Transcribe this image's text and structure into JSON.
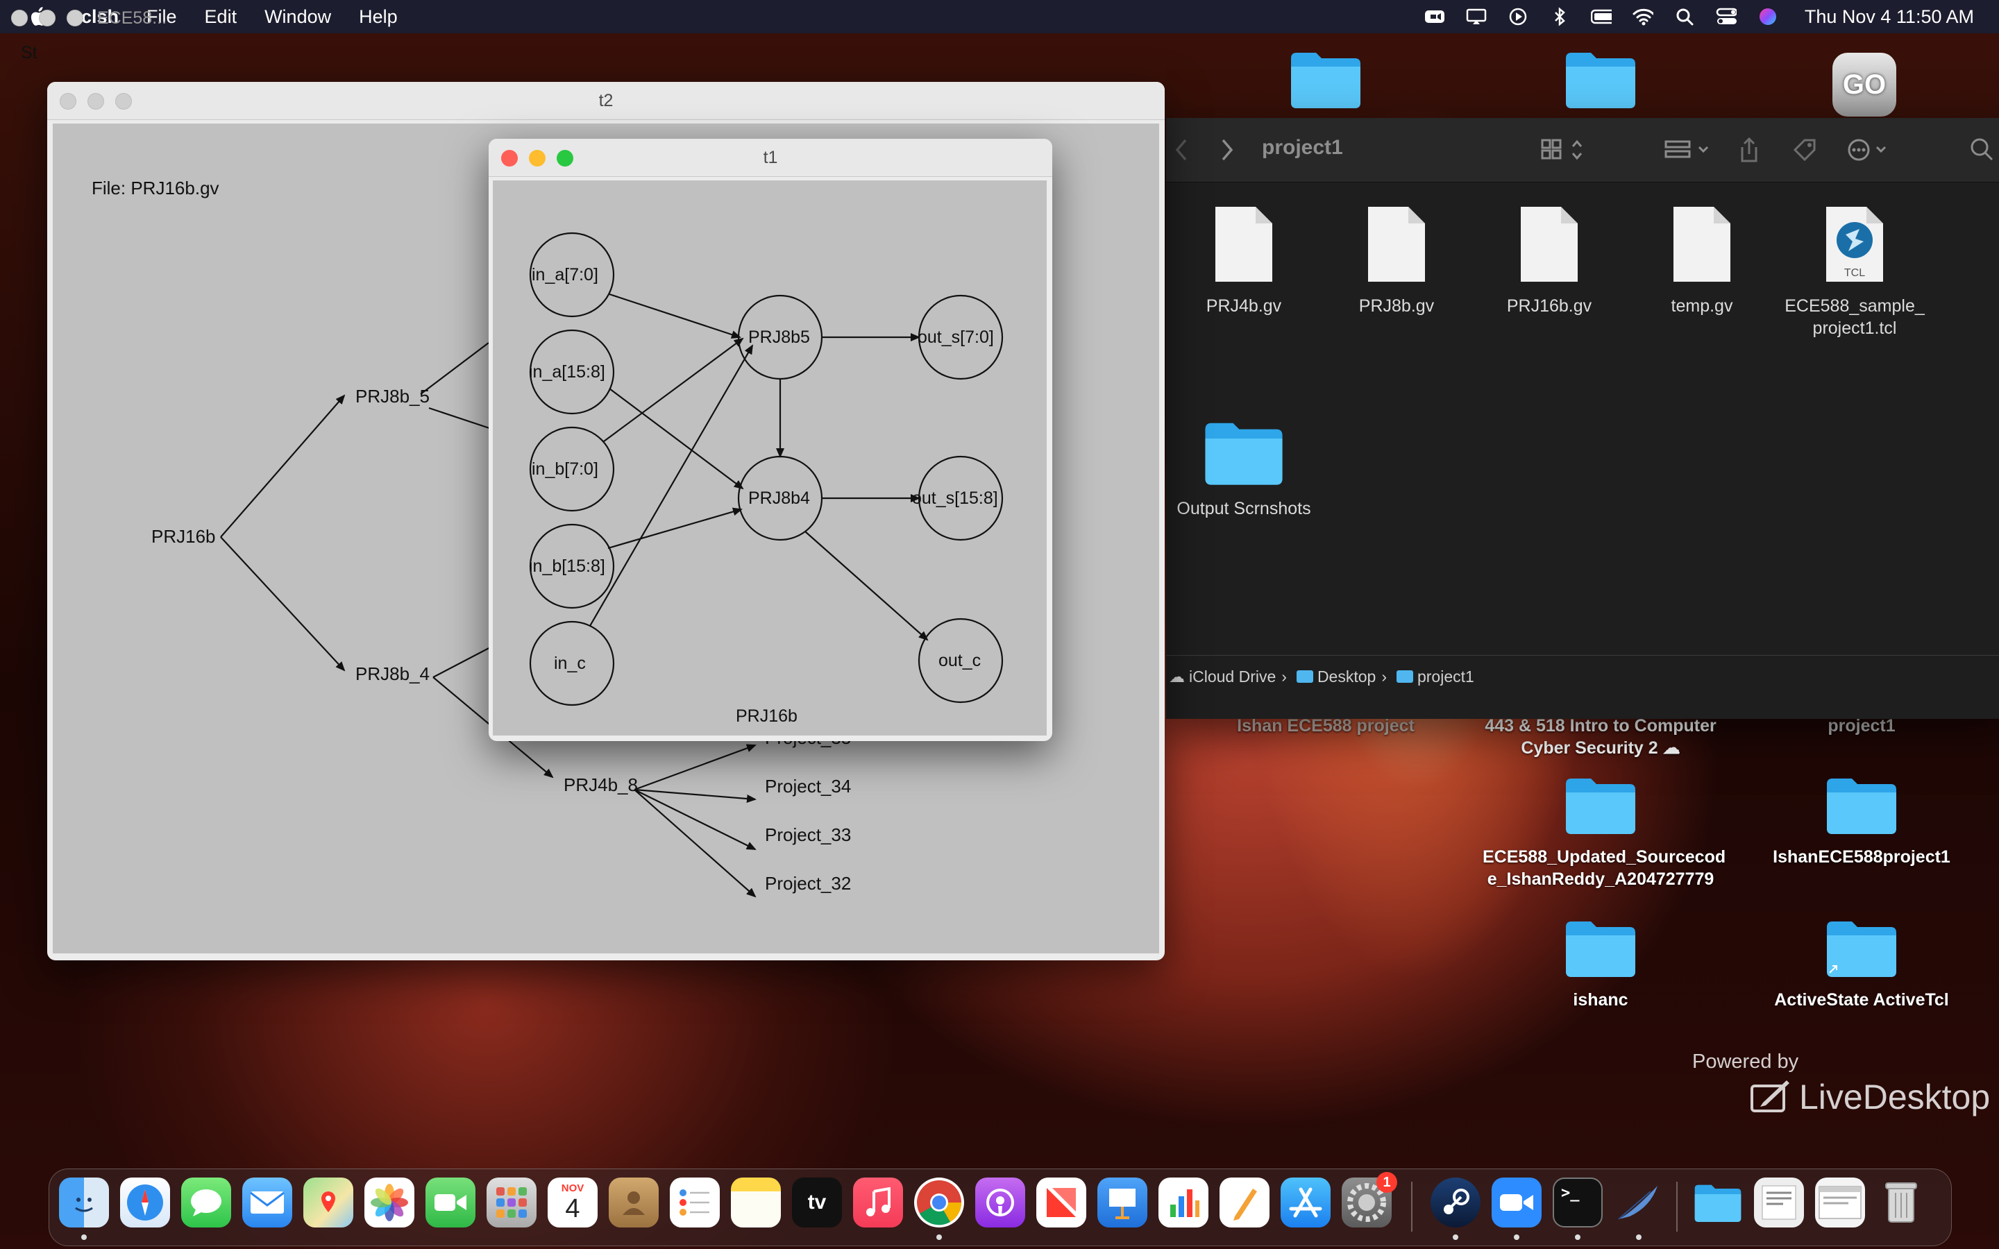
{
  "menubar": {
    "app_name": "tclsh",
    "menus": [
      "File",
      "Edit",
      "Window",
      "Help"
    ],
    "clock": "Thu Nov 4  11:50 AM",
    "status_icons": [
      "zoom-icon",
      "screen-mirror-icon",
      "play-icon",
      "bluetooth-icon",
      "battery-icon",
      "wifi-icon",
      "spotlight-icon",
      "control-center-icon",
      "siri-icon"
    ]
  },
  "window_ece": {
    "title": "ECE58...",
    "partial_text": "St"
  },
  "window_t2": {
    "title": "t2",
    "file_label": "File: PRJ16b.gv",
    "nodes": [
      "PRJ16b",
      "PRJ8b_5",
      "PRJ8b_4",
      "PRJ4b_8",
      "Project_35",
      "Project_34",
      "Project_33",
      "Project_32"
    ]
  },
  "window_t1": {
    "title": "t1",
    "graph_label": "PRJ16b",
    "nodes": [
      "in_a[7:0]",
      "in_a[15:8]",
      "in_b[7:0]",
      "in_b[15:8]",
      "in_c",
      "PRJ8b5",
      "PRJ8b4",
      "out_s[7:0]",
      "out_s[15:8]",
      "out_c"
    ]
  },
  "finder": {
    "title": "project1",
    "files": [
      {
        "name": "PRJ4b.gv",
        "icon": "document-icon"
      },
      {
        "name": "PRJ8b.gv",
        "icon": "document-icon"
      },
      {
        "name": "PRJ16b.gv",
        "icon": "document-icon"
      },
      {
        "name": "temp.gv",
        "icon": "document-icon"
      },
      {
        "name": "ECE588_sample_project1.tcl",
        "label_line1": "ECE588_sample_",
        "label_line2": "project1.tcl",
        "icon": "tcl-file-icon",
        "icon_text": "TCL"
      }
    ],
    "folders": [
      {
        "name": "Output Scrnshots"
      }
    ],
    "path": [
      "iCloud Drive",
      "Desktop",
      "project1"
    ]
  },
  "desktop": {
    "items": [
      {
        "line1": "Ishan ECE588 project",
        "line2": ""
      },
      {
        "line1": "443 & 518 Intro to Computer",
        "line2": "Cyber Security 2"
      },
      {
        "line1": "project1",
        "line2": ""
      },
      {
        "line1": "ECE588_Updated_Sourcecod",
        "line2": "e_IshanReddy_A204727779"
      },
      {
        "line1": "IshanECE588project1",
        "line2": ""
      },
      {
        "line1": "ishanc",
        "line2": ""
      },
      {
        "line1": "ActiveState ActiveTcl",
        "line2": ""
      }
    ],
    "go_badge": "GO",
    "live_powered": "Powered by",
    "live_brand": "LiveDesktop"
  },
  "dock": {
    "calendar_month": "NOV",
    "calendar_day": "4",
    "tv_label": "tv",
    "settings_badge": "1",
    "apps": [
      "Finder",
      "Safari",
      "Messages",
      "Mail",
      "Maps",
      "Photos",
      "FaceTime",
      "Launchpad",
      "Calendar",
      "Contacts",
      "Reminders",
      "Notes",
      "TV",
      "Music",
      "Chrome",
      "Podcasts",
      "News",
      "Keynote",
      "Numbers",
      "Pages",
      "App Store",
      "System Preferences",
      "Steam",
      "Zoom",
      "Terminal",
      "Tcl Feather",
      "Downloads",
      "Documents",
      "Chrome Window",
      "Trash"
    ]
  },
  "colors": {
    "menubar_bg": "#1c1d2e",
    "canvas_bg": "#c0c0c0",
    "finder_bg": "#1e1e1e",
    "folder_blue": "#5ac8fa",
    "close": "#fe5f57",
    "minimize": "#febc2e",
    "zoom": "#28c840"
  }
}
